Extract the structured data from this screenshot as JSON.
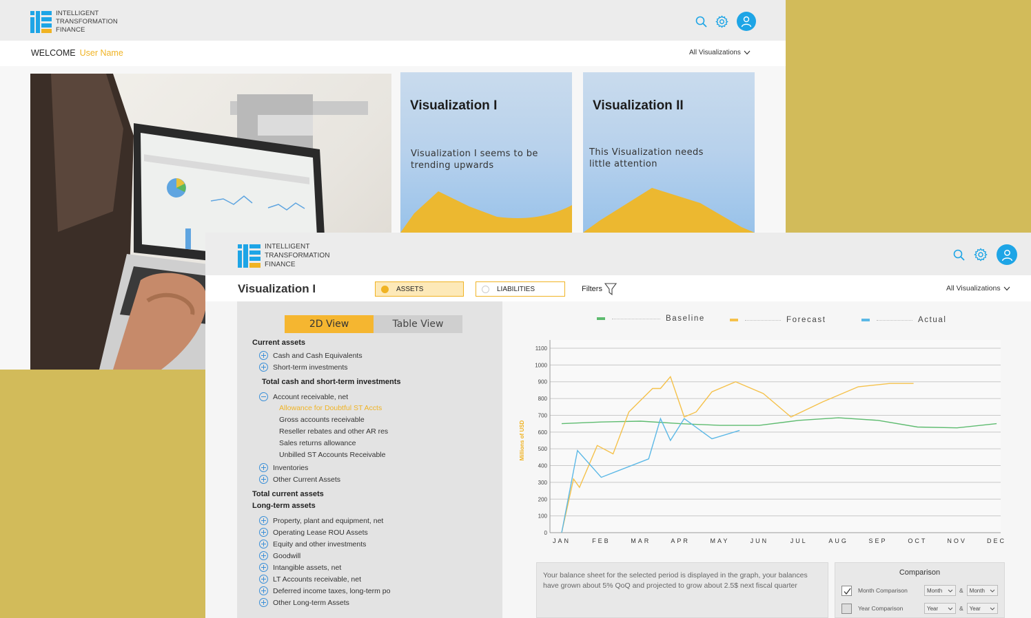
{
  "colors": {
    "accent": "#f0b323",
    "brand_blue": "#1ea5e6",
    "background_gold": "#d2bb5a",
    "baseline_green": "#5dbb6f",
    "forecast_yellow": "#f5c14a",
    "actual_blue": "#5bb8e6"
  },
  "brand": {
    "line1": "INTELLIGENT",
    "line2": "TRANSFORMATION",
    "line3": "FINANCE"
  },
  "home": {
    "welcome_label": "WELCOME",
    "user_name": "User Name",
    "all_visualizations": "All Visualizations",
    "cards": [
      {
        "title": "Visualization I",
        "text": "Visualization I seems to be trending upwards"
      },
      {
        "title": "Visualization II",
        "text": "This Visualization needs little attention"
      }
    ]
  },
  "detail": {
    "title": "Visualization I",
    "chips": {
      "assets": "ASSETS",
      "liabilities": "LIABILITIES"
    },
    "filters_label": "Filters",
    "all_visualizations": "All Visualizations",
    "tabs": {
      "view_2d": "2D View",
      "view_table": "Table View"
    },
    "tree": [
      "Current assets",
      "Cash and Cash Equivalents",
      "Short-term investments",
      "Total cash and short-term investments",
      "Account receivable, net",
      "Allowance for Doubtful ST Accts",
      "Gross accounts receivable",
      "Reseller rebates and other AR res",
      "Sales returns allowance",
      "Unbilled ST Accounts Receivable",
      "Inventories",
      "Other Current Assets",
      "Total current assets",
      "Long-term assets",
      "Property, plant and equipment, net",
      "Operating Lease ROU Assets",
      "Equity and other investments",
      "Goodwill",
      "Intangible assets, net",
      "LT Accounts receivable, net",
      "Deferred income taxes, long-term po",
      "Other Long-term Assets"
    ],
    "summary": "Your balance sheet for the selected period is displayed in the graph, your balances have grown about 5% QoQ and projected to grow about 2.5$ next fiscal quarter",
    "comparison": {
      "title": "Comparison",
      "month_label": "Month Comparison",
      "month_sel_a": "Month",
      "month_sel_b": "Month",
      "year_label": "Year Comparison",
      "year_sel_a": "Year",
      "year_sel_b": "Year",
      "amp": "&",
      "month_checked": true,
      "year_checked": false
    }
  },
  "chart_data": {
    "type": "line",
    "title": "",
    "xlabel": "",
    "ylabel": "Millions of USD",
    "x": [
      "JAN",
      "FEB",
      "MAR",
      "APR",
      "MAY",
      "JUN",
      "JUL",
      "AUG",
      "SEP",
      "OCT",
      "NOV",
      "DEC"
    ],
    "yticks": [
      0,
      100,
      200,
      300,
      400,
      500,
      600,
      700,
      800,
      900,
      1000,
      1100
    ],
    "ylim": [
      0,
      1100
    ],
    "grid": true,
    "legend": "top",
    "series": [
      {
        "name": "Baseline",
        "color": "#5dbb6f",
        "points": [
          [
            0,
            650
          ],
          [
            1,
            660
          ],
          [
            2,
            665
          ],
          [
            3,
            650
          ],
          [
            4,
            640
          ],
          [
            5,
            640
          ],
          [
            6,
            670
          ],
          [
            7,
            685
          ],
          [
            8,
            670
          ],
          [
            9,
            630
          ],
          [
            10,
            625
          ],
          [
            11,
            650
          ]
        ]
      },
      {
        "name": "Forecast",
        "color": "#f5c14a",
        "points": [
          [
            0,
            0
          ],
          [
            0.3,
            320
          ],
          [
            0.45,
            270
          ],
          [
            0.9,
            520
          ],
          [
            1.3,
            470
          ],
          [
            1.7,
            720
          ],
          [
            2.3,
            860
          ],
          [
            2.5,
            860
          ],
          [
            2.75,
            930
          ],
          [
            3.1,
            690
          ],
          [
            3.4,
            720
          ],
          [
            3.8,
            840
          ],
          [
            4.4,
            900
          ],
          [
            5.1,
            830
          ],
          [
            5.8,
            690
          ],
          [
            6.6,
            780
          ],
          [
            7.5,
            870
          ],
          [
            8.3,
            890
          ],
          [
            8.9,
            890
          ]
        ]
      },
      {
        "name": "Actual",
        "color": "#5bb8e6",
        "points": [
          [
            0,
            0
          ],
          [
            0.4,
            490
          ],
          [
            1,
            330
          ],
          [
            2.2,
            440
          ],
          [
            2.5,
            680
          ],
          [
            2.75,
            550
          ],
          [
            3.1,
            680
          ],
          [
            3.8,
            560
          ],
          [
            4.5,
            610
          ]
        ]
      }
    ]
  }
}
